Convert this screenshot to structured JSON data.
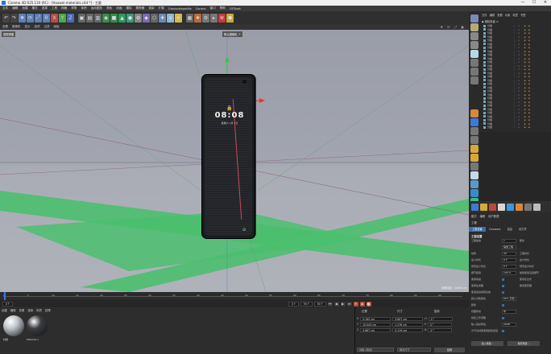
{
  "window": {
    "title": "Cinema 4D R25.110 (RC) - [Huawei-materials.c4d *] - 主要",
    "controls": [
      "—",
      "☐",
      "✕"
    ]
  },
  "menubar": [
    "文件",
    "编辑",
    "创建",
    "模式",
    "选择",
    "工具",
    "网格",
    "样条",
    "体积",
    "运动图形",
    "角色",
    "动画",
    "模拟",
    "跟踪器",
    "渲染",
    "扩展",
    "Greyscalegorilla",
    "Corona",
    "窗口",
    "帮助",
    "GSTools"
  ],
  "toolbar": {
    "icons": [
      "↶",
      "↷",
      "✥",
      "⟳",
      "⤢",
      "R",
      "X",
      "Y",
      "Z",
      "▣",
      "▤",
      "▥",
      "◉",
      "■",
      "▲",
      "●",
      "✿",
      "◆",
      "⬡",
      "✚",
      "⊕",
      "☀",
      "▦",
      "❖",
      "⚙",
      "▸",
      "☢",
      "⬢"
    ]
  },
  "viewport_menu": {
    "items": [
      "查看",
      "摄像机",
      "显示",
      "选项",
      "过滤",
      "面板"
    ],
    "nav": "✥ ⟳ ⤢ ▣",
    "label": "透视视图",
    "camera": "默认摄像机 ·•",
    "grid_info": "网格间距 : 10000 cm"
  },
  "phone": {
    "lock": "🔒",
    "time": "08:08",
    "date": "星期六 1月 1日",
    "camera_icon": "⊙"
  },
  "timeline": {
    "ticks": [
      "0",
      "5",
      "10",
      "15",
      "20",
      "25",
      "30",
      "35",
      "40",
      "45",
      "50",
      "55",
      "60",
      "65",
      "70",
      "75",
      "80",
      "85",
      "90"
    ]
  },
  "transport": {
    "current": "0 F",
    "start": "0 F",
    "end": "90 F",
    "end2": "90 F",
    "buttons": [
      "⏮",
      "◀",
      "▶",
      "⏭",
      "⏺",
      "◆",
      "⬤"
    ]
  },
  "materials": {
    "menu": [
      "创建",
      "编辑",
      "查看",
      "选择",
      "材质",
      "纹理"
    ],
    "items": [
      {
        "name": "材质",
        "color": "#bfc5cc"
      },
      {
        "name": "Material.1",
        "color": "#3b3d42"
      }
    ]
  },
  "coords": {
    "headers": [
      "位置",
      "尺寸",
      "旋转"
    ],
    "rows": [
      {
        "axis": "X",
        "pos": "0.165 cm",
        "size": "5.607 cm",
        "rot_axis": "H",
        "rot": "0 °"
      },
      {
        "axis": "Y",
        "pos": "15.043 cm",
        "size": "1.176 cm",
        "rot_axis": "P",
        "rot": "0 °"
      },
      {
        "axis": "Z",
        "pos": "0.667 cm",
        "size": "0.119 cm",
        "rot_axis": "B",
        "rot": "0 °"
      }
    ],
    "mode": "对象 (相对)",
    "size_mode": "绝对尺寸",
    "apply": "应用"
  },
  "object_manager": {
    "menu": [
      "文件",
      "编辑",
      "查看",
      "对象",
      "标签",
      "书签"
    ],
    "root": "◆ 相机背景 ⊙",
    "rows": [
      "分组",
      "分组",
      "分组",
      "分组",
      "分组",
      "分组",
      "分组",
      "分组",
      "分组",
      "分组",
      "分组",
      "分组",
      "分组",
      "分组",
      "分组",
      "分组",
      "分组",
      "分组",
      "分组",
      "分组",
      "分组",
      "分组",
      "分组",
      "分组",
      "分组",
      "分组",
      "分组",
      "分组",
      "分组"
    ],
    "flags": "⋮ ✓",
    "tags": "◈ ◈"
  },
  "attr": {
    "menu": [
      "模式",
      "编辑",
      "用户数据"
    ],
    "title": "工程",
    "tabs": [
      "工程设置",
      "Cineware",
      "信息",
      "动力学"
    ],
    "section": "工程设置",
    "rows": [
      {
        "lbl": "工程缩放",
        "val": "1",
        "lbl2": "厘米"
      },
      {
        "lbl": "",
        "val": "缩放工程...",
        "lbl2": ""
      },
      {
        "lbl": "帧率",
        "val": "30",
        "lbl2": "工程时长"
      },
      {
        "lbl": "最小时长",
        "val": "0 F",
        "lbl2": "最大时长"
      },
      {
        "lbl": "预览最小时长",
        "val": "0 F",
        "lbl2": "预览最大时长"
      },
      {
        "lbl": "细节级别",
        "val": "100 %",
        "lbl2": "编辑使用渲染细节"
      },
      {
        "lbl": "使用动画",
        "val": "",
        "lbl2": "使用表达式"
      },
      {
        "lbl": "使用生成器",
        "val": "",
        "lbl2": "使用变形器"
      },
      {
        "lbl": "使用运动剪辑系统",
        "val": "",
        "lbl2": ""
      },
      {
        "lbl": "默认对象颜色",
        "val": "60% 灰色",
        "lbl2": ""
      },
      {
        "lbl": "颜色",
        "val": "",
        "lbl2": ""
      },
      {
        "lbl": "视图修剪",
        "val": "中",
        "lbl2": ""
      },
      {
        "lbl": "线性工作流程",
        "val": "",
        "lbl2": ""
      },
      {
        "lbl": "输入色彩特性",
        "val": "sRGB",
        "lbl2": ""
      },
      {
        "lbl": "为节点材质使用颜色通道",
        "val": "",
        "lbl2": ""
      }
    ],
    "btn1": "载入预置...",
    "btn2": "保存预置..."
  }
}
